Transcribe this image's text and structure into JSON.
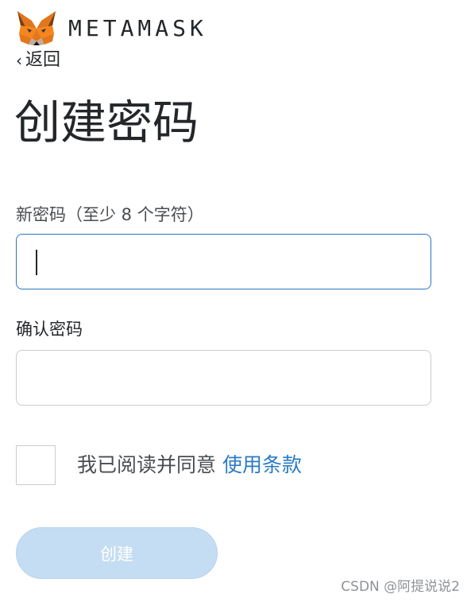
{
  "header": {
    "logo_icon": "metamask-fox-icon",
    "wordmark": "METAMASK",
    "back_label": "返回",
    "back_icon": "chevron-left-icon"
  },
  "page": {
    "title": "创建密码"
  },
  "form": {
    "new_password_label": "新密码（至少 8 个字符）",
    "new_password_value": "",
    "confirm_password_label": "确认密码",
    "confirm_password_value": "",
    "terms_prefix": "我已阅读并同意 ",
    "terms_link": "使用条款",
    "terms_checked": false,
    "submit_label": "创建",
    "submit_enabled": false
  },
  "watermark": "CSDN @阿提说说2",
  "colors": {
    "accent": "#2b7bc4",
    "focus_border": "#2a76c6",
    "disabled_button": "#c4ddf2",
    "text": "#24272a"
  }
}
